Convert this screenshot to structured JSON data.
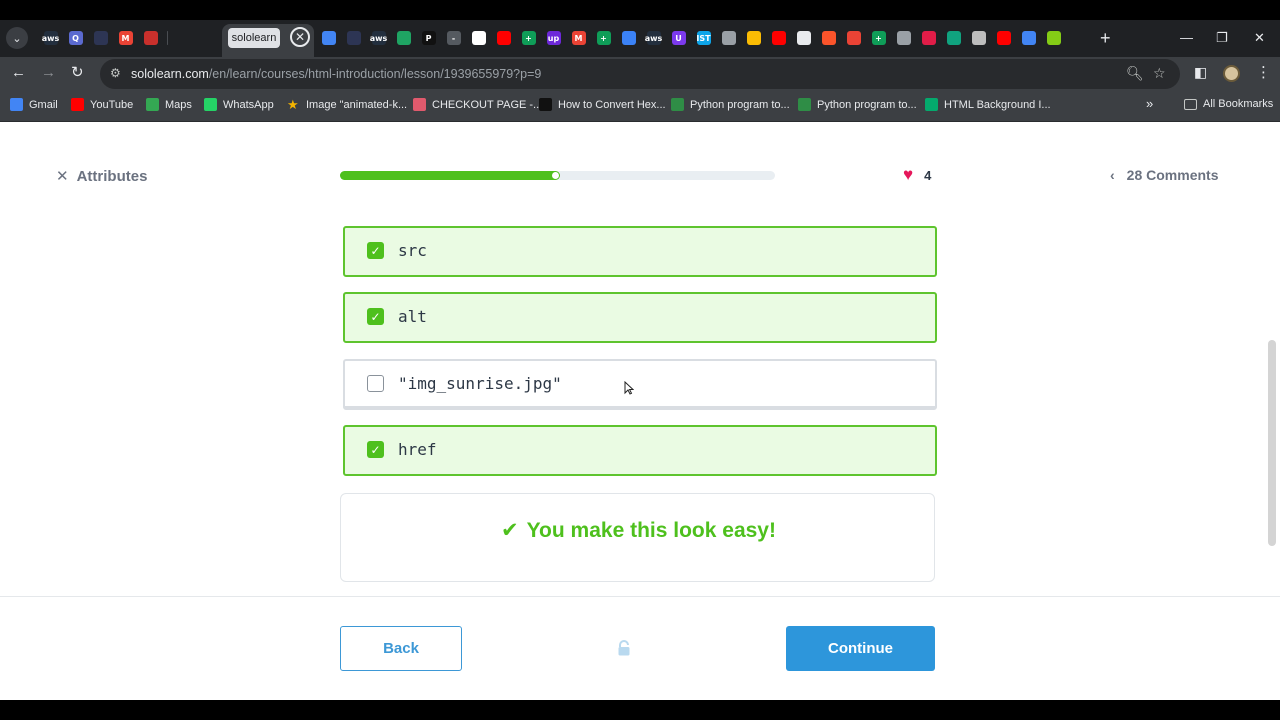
{
  "browser": {
    "active_tab_title": "sololearn",
    "url_host": "sololearn.com",
    "url_path": "/en/learn/courses/html-introduction/lesson/1939655979?p=9",
    "tab_favicons": [
      {
        "name": "aws-favicon",
        "color": "#232f3e",
        "glyph": "aws"
      },
      {
        "name": "quiz-favicon",
        "color": "#5b6ad0",
        "glyph": "Q"
      },
      {
        "name": "dark-app-favicon",
        "color": "#2d3554",
        "glyph": ""
      },
      {
        "name": "gmail-favicon",
        "color": "#ea4335",
        "glyph": "M"
      },
      {
        "name": "news-favicon",
        "color": "#c9302c",
        "glyph": ""
      },
      {
        "name": "sep",
        "color": "",
        "glyph": ""
      }
    ],
    "tab_favicons_right": [
      {
        "name": "chrome-color-favicon",
        "color": "#4285f4",
        "glyph": ""
      },
      {
        "name": "dark-app-favicon",
        "color": "#2d3554",
        "glyph": ""
      },
      {
        "name": "aws-favicon",
        "color": "#232f3e",
        "glyph": "aws"
      },
      {
        "name": "drive-favicon",
        "color": "#1fa463",
        "glyph": ""
      },
      {
        "name": "notion-favicon",
        "color": "#111111",
        "glyph": "P"
      },
      {
        "name": "dash-favicon",
        "color": "#555a60",
        "glyph": "-"
      },
      {
        "name": "hashnode-favicon",
        "color": "#ffffff",
        "glyph": ""
      },
      {
        "name": "youtube-favicon",
        "color": "#ff0000",
        "glyph": ""
      },
      {
        "name": "sheets-favicon",
        "color": "#0f9d58",
        "glyph": "+"
      },
      {
        "name": "upwork-favicon",
        "color": "#6d28d9",
        "glyph": "up"
      },
      {
        "name": "gmail-favicon",
        "color": "#ea4335",
        "glyph": "M"
      },
      {
        "name": "sheets-favicon",
        "color": "#0f9d58",
        "glyph": "+"
      },
      {
        "name": "pen-favicon",
        "color": "#3b82f6",
        "glyph": ""
      },
      {
        "name": "aws-favicon",
        "color": "#232f3e",
        "glyph": "aws"
      },
      {
        "name": "shield-favicon",
        "color": "#7c3aed",
        "glyph": "U"
      },
      {
        "name": "ist-favicon",
        "color": "#0ea5e9",
        "glyph": "IST"
      },
      {
        "name": "robot-favicon",
        "color": "#9aa0a6",
        "glyph": ""
      },
      {
        "name": "ads-favicon",
        "color": "#fbbc04",
        "glyph": ""
      },
      {
        "name": "youtube-favicon",
        "color": "#ff0000",
        "glyph": ""
      },
      {
        "name": "doc-favicon",
        "color": "#e8eaed",
        "glyph": ""
      },
      {
        "name": "brave-favicon",
        "color": "#fb542b",
        "glyph": ""
      },
      {
        "name": "maps-favicon",
        "color": "#ea4335",
        "glyph": ""
      },
      {
        "name": "sheets-favicon",
        "color": "#0f9d58",
        "glyph": "+"
      },
      {
        "name": "globe-favicon",
        "color": "#9aa0a6",
        "glyph": ""
      },
      {
        "name": "news-favicon",
        "color": "#e11d48",
        "glyph": ""
      },
      {
        "name": "chatgpt-favicon",
        "color": "#10a37f",
        "glyph": ""
      },
      {
        "name": "emblem-favicon",
        "color": "#bdbdbd",
        "glyph": ""
      },
      {
        "name": "youtube-favicon",
        "color": "#ff0000",
        "glyph": ""
      },
      {
        "name": "chrome-color-favicon",
        "color": "#4285f4",
        "glyph": ""
      },
      {
        "name": "green-app-favicon",
        "color": "#84cc16",
        "glyph": ""
      }
    ],
    "bookmarks": [
      {
        "label": "Gmail",
        "icon": "google-apps-icon",
        "color": "#4285f4"
      },
      {
        "label": "YouTube",
        "icon": "youtube-icon",
        "color": "#ff0000"
      },
      {
        "label": "Maps",
        "icon": "maps-icon",
        "color": "#34a853"
      },
      {
        "label": "WhatsApp",
        "icon": "whatsapp-icon",
        "color": "#25d366"
      },
      {
        "label": "Image \"animated-k...",
        "icon": "star-icon",
        "color": "#f4b400"
      },
      {
        "label": "CHECKOUT PAGE -...",
        "icon": "checkout-icon",
        "color": "#e05a6d"
      },
      {
        "label": "How to Convert Hex...",
        "icon": "alpha-icon",
        "color": "#111111"
      },
      {
        "label": "Python program to...",
        "icon": "gfg-icon",
        "color": "#2f8d46"
      },
      {
        "label": "Python program to...",
        "icon": "gfg-icon",
        "color": "#2f8d46"
      },
      {
        "label": "HTML Background I...",
        "icon": "w3-icon",
        "color": "#04aa6d"
      }
    ],
    "all_bookmarks_label": "All Bookmarks"
  },
  "lesson": {
    "close_label": "Attributes",
    "progress_fraction": 0.5,
    "hearts_count": "4",
    "comments_label": "28 Comments",
    "options": [
      {
        "text": "src",
        "checked": true,
        "top": 0
      },
      {
        "text": "alt",
        "checked": true
      },
      {
        "text": "\"img_sunrise.jpg\"",
        "checked": false
      },
      {
        "text": "href",
        "checked": true
      }
    ],
    "feedback_message": "You make this look easy!",
    "back_label": "Back",
    "continue_label": "Continue"
  },
  "colors": {
    "accent_green": "#4ec01d",
    "accent_blue": "#2d96db",
    "heart": "#e5175a"
  }
}
